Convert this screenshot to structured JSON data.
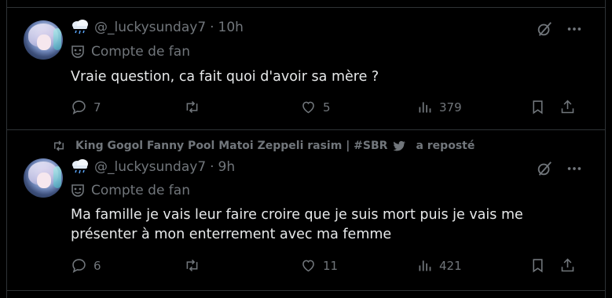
{
  "posts": [
    {
      "handle": "@_luckysunday7",
      "separator": "·",
      "time": "10h",
      "badge": "Compte de fan",
      "text": "Vraie question, ca fait quoi d'avoir sa mère ?",
      "replies": "7",
      "reposts": "",
      "likes": "5",
      "views": "379"
    },
    {
      "reposted_by": "King Gogol Fanny Pool Matoi Zeppeli rasim | #SBR",
      "reposted_suffix": "a reposté",
      "handle": "@_luckysunday7",
      "separator": "·",
      "time": "9h",
      "badge": "Compte de fan",
      "text": "Ma famille je vais leur faire croire que je suis mort puis je vais me présenter à mon enterrement avec ma femme",
      "replies": "6",
      "reposts": "",
      "likes": "11",
      "views": "421"
    }
  ],
  "icons": [
    "cloud-rain-icon",
    "mask-icon",
    "grok-icon",
    "more-icon",
    "reply-icon",
    "repost-icon",
    "like-icon",
    "views-icon",
    "bookmark-icon",
    "share-icon"
  ],
  "colors": {
    "background": "#000000",
    "text": "#e7e9ea",
    "muted": "#71767b",
    "border": "#2f3336"
  }
}
